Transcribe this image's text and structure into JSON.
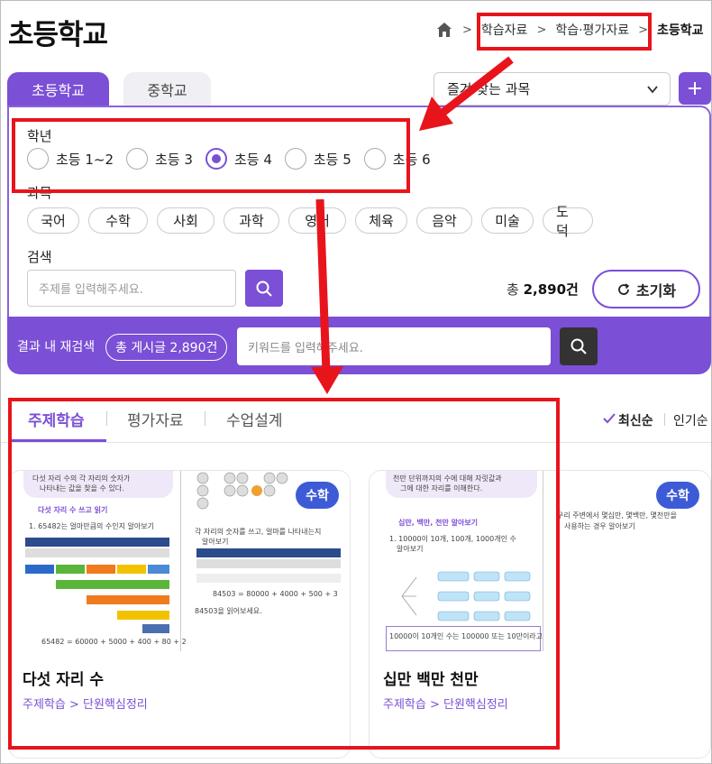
{
  "header": {
    "title": "초등학교",
    "breadcrumb": [
      "학습자료",
      "학습·평가자료",
      "초등학교"
    ]
  },
  "school_tabs": [
    "초등학교",
    "중학교"
  ],
  "subject_select": {
    "value": "즐겨 찾는 과목"
  },
  "filters": {
    "grade_label": "학년",
    "grades": [
      "초등 1~2",
      "초등 3",
      "초등 4",
      "초등 5",
      "초등 6"
    ],
    "selected_grade": "초등 4",
    "subject_label": "과목",
    "subjects": [
      "국어",
      "수학",
      "사회",
      "과학",
      "영어",
      "체육",
      "음악",
      "미술",
      "도덕"
    ],
    "search_label": "검색",
    "search_placeholder": "주제를 입력해주세요.",
    "total_prefix": "총",
    "total_value": "2,890건",
    "reset_label": "초기화"
  },
  "research": {
    "label": "결과 내 재검색",
    "count": "총 게시글 2,890건",
    "placeholder": "키워드를 입력해주세요."
  },
  "content_tabs": [
    "주제학습",
    "평가자료",
    "수업설계"
  ],
  "sort": [
    "최신순",
    "인기순"
  ],
  "cards": [
    {
      "title": "다섯 자리 수",
      "path": "주제학습 > 단원핵심정리",
      "badge": "수학",
      "thumb_text": [
        "다섯 자리 수의 각 자리의 숫자가",
        "나타내는 값을 찾을 수 있다.",
        "다섯 자리 수 쓰고 읽기",
        "1. 65482는 얼마만큼의 수인지 알아보기",
        "각 자리의 숫자를 쓰고, 얼마를 나타내는지",
        "알아보기",
        "84503 = 80000 + 4000 + 500 + 3",
        "84503을 읽어보세요.",
        "65482 = 60000 + 5000 + 400 + 80 + 2"
      ]
    },
    {
      "title": "십만 백만 천만",
      "path": "주제학습 > 단원핵심정리",
      "badge": "수학",
      "thumb_text": [
        "천만 단위까지의 수에 대해 자릿값과",
        "그에 대한 자리를 이해한다.",
        "십만, 백만, 천만 알아보기",
        "1. 10000이 10개, 100개, 1000개인 수",
        "알아보기",
        "우리 주변에서 몇십만, 몇백만, 몇천만을",
        "사용하는 경우 알아보기",
        "10000이 10개인 수는 100000 또는 10만이라고"
      ]
    }
  ]
}
